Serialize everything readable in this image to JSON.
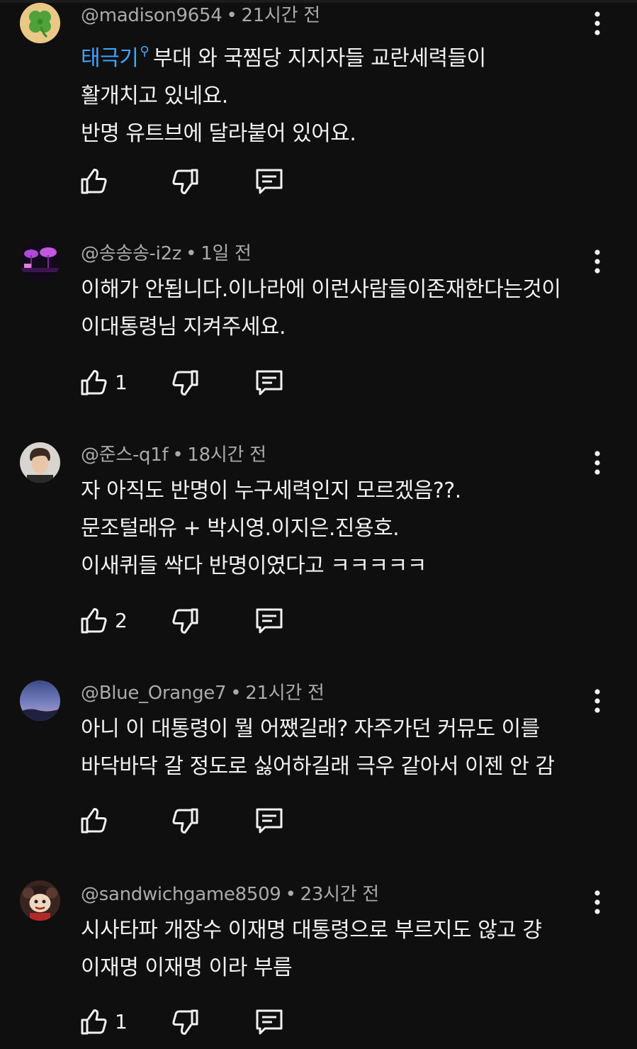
{
  "comments": [
    {
      "handle": "@madison9654",
      "time": "21시간 전",
      "tag_link": "태극기",
      "lines": [
        "부대 와 국찜당 지지자들  교란세력들이",
        "활개치고 있네요.",
        "반명 유트브에 달라붙어 있어요."
      ],
      "likes": "",
      "avatar_icon": "four-leaf-clover"
    },
    {
      "handle": "@송송송-i2z",
      "time": "1일 전",
      "lines": [
        "이해가 안됩니다.이나라에 이런사람들이존재한다는것이",
        "이대통령님 지켜주세요."
      ],
      "likes": "1",
      "avatar_icon": "purple-night-scene"
    },
    {
      "handle": "@준스-q1f",
      "time": "18시간 전",
      "lines": [
        "자 아직도 반명이 누구세력인지 모르겠음??.",
        "문조털래유 + 박시영.이지은.진용호.",
        "이새퀴들 싹다 반명이였다고 ㅋㅋㅋㅋㅋ"
      ],
      "likes": "2",
      "avatar_icon": "person-photo"
    },
    {
      "handle": "@Blue_Orange7",
      "time": "21시간 전",
      "lines": [
        "아니 이 대통령이 뭘 어쨌길래? 자주가던 커뮤도 이를",
        "바닥바닥 갈 정도로 싫어하길래 극우 같아서 이젠 안 감"
      ],
      "likes": "",
      "avatar_icon": "dusk-sky"
    },
    {
      "handle": "@sandwichgame8509",
      "time": "23시간 전",
      "lines": [
        "시사타파 개장수 이재명 대통령으로 부르지도 않고 걍",
        "이재명 이재명 이라 부름"
      ],
      "likes": "1",
      "avatar_icon": "cartoon-character"
    }
  ],
  "colors": {
    "background": "#0f0f0f",
    "text": "#f1f1f1",
    "meta": "#aaaaaa",
    "link": "#3ea6ff"
  },
  "icons": {
    "like": "thumbs-up-icon",
    "dislike": "thumbs-down-icon",
    "reply": "reply-icon",
    "menu": "kebab-menu-icon"
  }
}
